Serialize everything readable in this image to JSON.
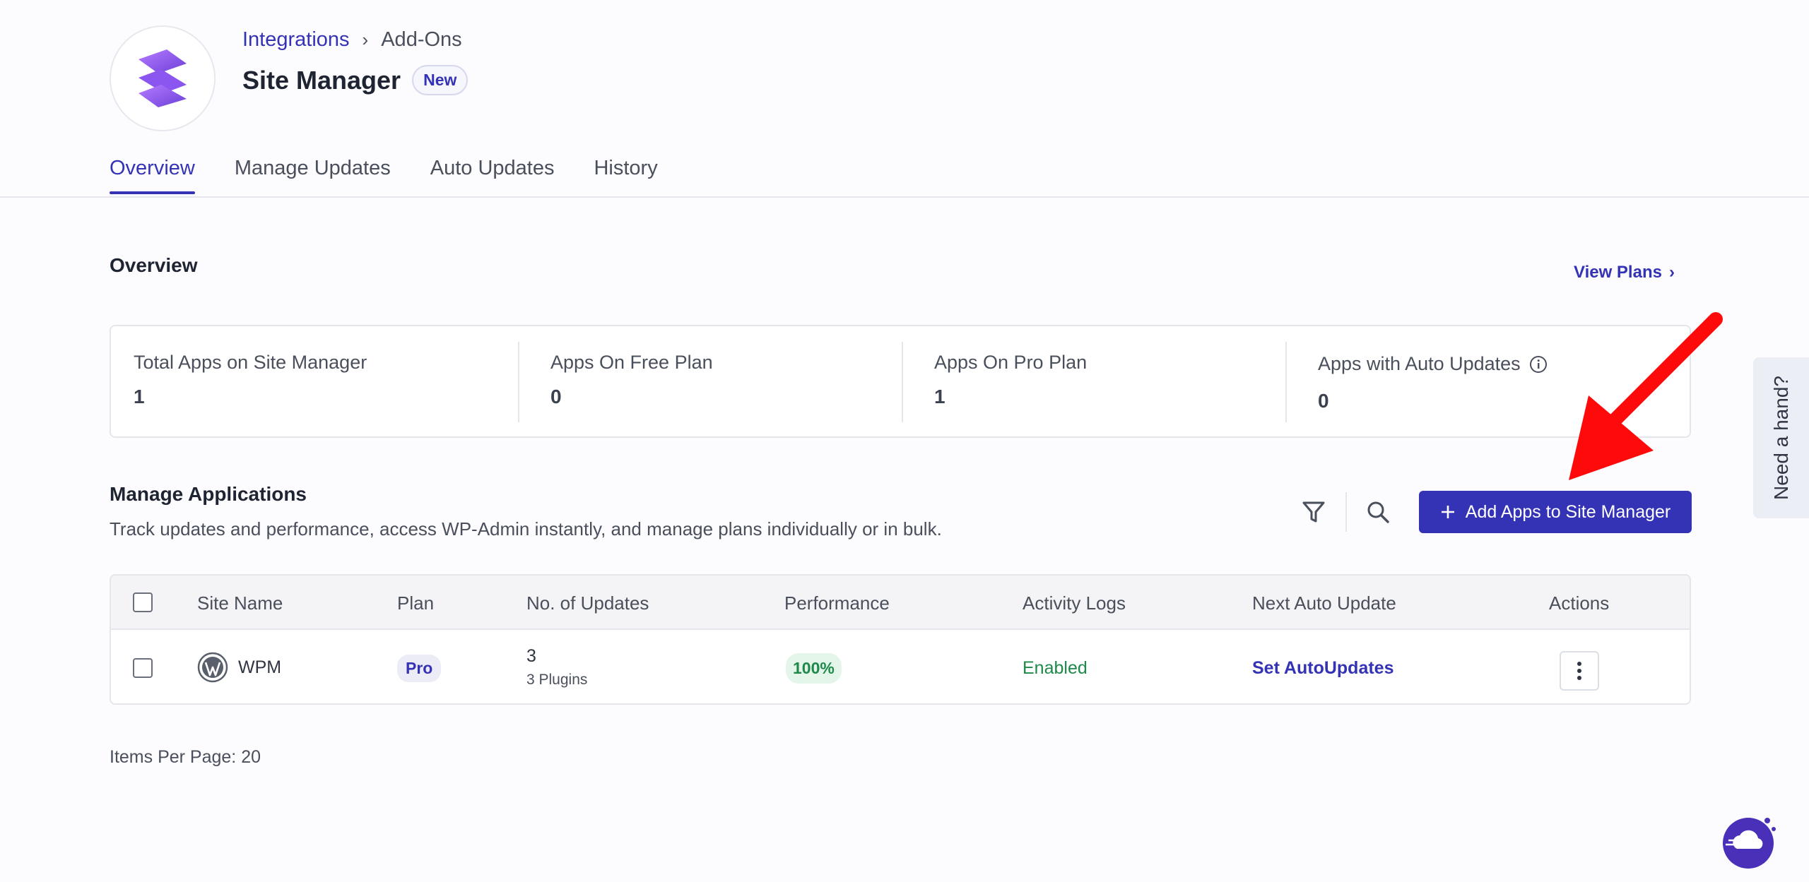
{
  "breadcrumb": {
    "parent": "Integrations",
    "current": "Add-Ons"
  },
  "title": "Site Manager",
  "title_badge": "New",
  "tabs": [
    {
      "label": "Overview",
      "active": true
    },
    {
      "label": "Manage Updates",
      "active": false
    },
    {
      "label": "Auto Updates",
      "active": false
    },
    {
      "label": "History",
      "active": false
    }
  ],
  "overview": {
    "title": "Overview",
    "view_plans": "View Plans",
    "stats": [
      {
        "label": "Total Apps on Site Manager",
        "value": "1"
      },
      {
        "label": "Apps On Free Plan",
        "value": "0"
      },
      {
        "label": "Apps On Pro Plan",
        "value": "1"
      },
      {
        "label": "Apps with Auto Updates",
        "value": "0"
      }
    ]
  },
  "manage": {
    "title": "Manage Applications",
    "description": "Track updates and performance, access WP-Admin instantly, and manage plans individually or in bulk.",
    "add_button": "Add Apps to Site Manager"
  },
  "table": {
    "columns": [
      "Site Name",
      "Plan",
      "No. of Updates",
      "Performance",
      "Activity Logs",
      "Next Auto Update",
      "Actions"
    ],
    "rows": [
      {
        "site_name": "WPM",
        "plan": "Pro",
        "updates_count": "3",
        "updates_detail": "3 Plugins",
        "performance": "100%",
        "activity_logs": "Enabled",
        "next_auto_update": "Set AutoUpdates"
      }
    ]
  },
  "pagination": {
    "items_per_page": "Items Per Page: 20"
  },
  "help_tab": "Need a hand?",
  "colors": {
    "accent": "#3533b5",
    "success": "#1d8a4a",
    "arrow": "#ff0a0a"
  },
  "icons": [
    "site-manager-logo-icon",
    "chevron-right-icon",
    "info-icon",
    "filter-icon",
    "search-icon",
    "plus-icon",
    "wordpress-icon",
    "kebab-menu-icon",
    "chat-cloud-icon"
  ]
}
